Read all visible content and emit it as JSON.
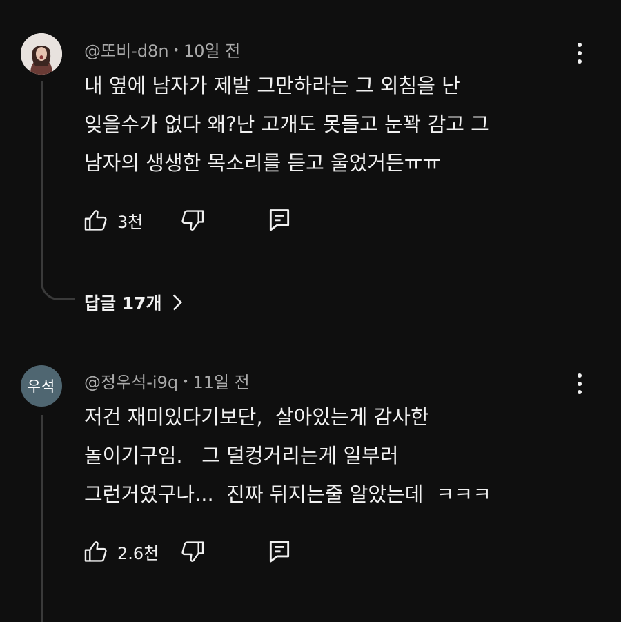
{
  "comments": [
    {
      "author": "@또비-d8n",
      "time": "10일 전",
      "avatar_type": "photo",
      "lines": [
        "내 옆에 남자가 제발 그만하라는 그 외침을 난",
        "잊을수가 없다 왜?난 고개도 못들고 눈꽉 감고 그",
        "남자의 생생한 목소리를 듣고 울었거든ㅠㅠ"
      ],
      "likes": "3천",
      "replies_label": "답글 17개"
    },
    {
      "author": "@정우석-i9q",
      "time": "11일 전",
      "avatar_type": "initials",
      "avatar_initials": "우석",
      "avatar_color": "#4f6671",
      "lines": [
        "저건 재미있다기보단,  살아있는게 감사한",
        "놀이기구임.   그 덜컹거리는게 일부러",
        "그런거였구나...  진짜 뒤지는줄 알았는데  ㅋㅋㅋ"
      ],
      "likes": "2.6천"
    }
  ],
  "separator": "•",
  "colors": {
    "background": "#0f0f0f",
    "text_primary": "#f1f1f1",
    "text_secondary": "#aaaaaa",
    "thread_line": "#3a3a3a"
  },
  "icons": {
    "like": "thumbs-up-icon",
    "dislike": "thumbs-down-icon",
    "reply": "comment-reply-icon",
    "menu": "more-vert-icon",
    "chevron": "chevron-right-icon"
  }
}
